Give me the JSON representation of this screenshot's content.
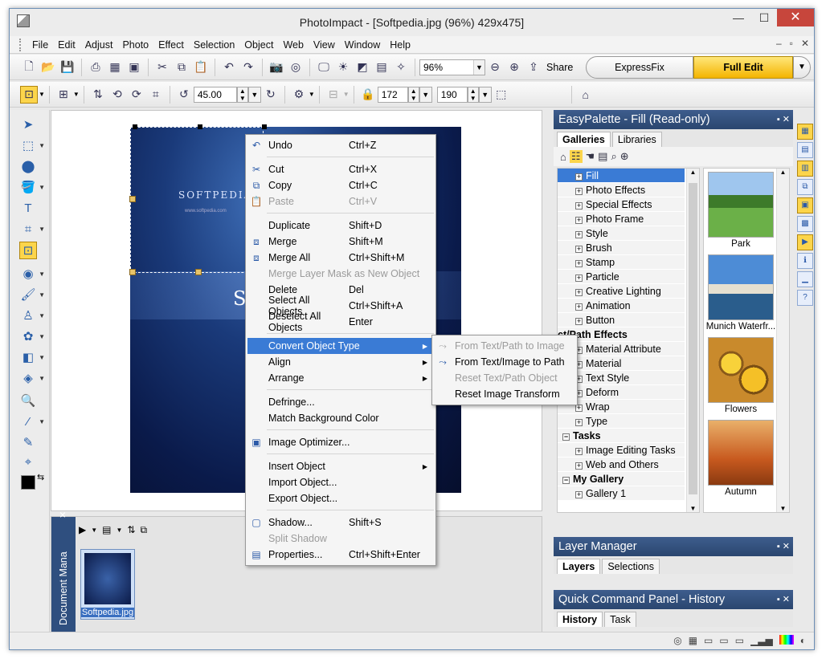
{
  "window": {
    "title": "PhotoImpact - [Softpedia.jpg (96%) 429x475]"
  },
  "menubar": [
    "File",
    "Edit",
    "Adjust",
    "Photo",
    "Effect",
    "Selection",
    "Object",
    "Web",
    "View",
    "Window",
    "Help"
  ],
  "toolbar1": {
    "zoom_value": "96%",
    "share_label": "Share",
    "expressfix_label": "ExpressFix",
    "fulledit_label": "Full Edit"
  },
  "toolbar2": {
    "rotate_value": "45.00",
    "width_value": "172",
    "height_value": "190"
  },
  "document": {
    "logo_text": "SOFTPEDIA",
    "url_text": "www.softpedia.com",
    "big_letter": "S"
  },
  "context_menu": {
    "items": [
      {
        "label": "Undo",
        "shortcut": "Ctrl+Z"
      },
      {
        "label": "Cut",
        "shortcut": "Ctrl+X"
      },
      {
        "label": "Copy",
        "shortcut": "Ctrl+C"
      },
      {
        "label": "Paste",
        "shortcut": "Ctrl+V"
      },
      {
        "label": "Duplicate",
        "shortcut": "Shift+D"
      },
      {
        "label": "Merge",
        "shortcut": "Shift+M"
      },
      {
        "label": "Merge All",
        "shortcut": "Ctrl+Shift+M"
      },
      {
        "label": "Merge Layer Mask as New Object",
        "shortcut": ""
      },
      {
        "label": "Delete",
        "shortcut": "Del"
      },
      {
        "label": "Select All Objects",
        "shortcut": "Ctrl+Shift+A"
      },
      {
        "label": "Deselect All Objects",
        "shortcut": "Enter"
      },
      {
        "label": "Convert Object Type",
        "shortcut": ""
      },
      {
        "label": "Align",
        "shortcut": ""
      },
      {
        "label": "Arrange",
        "shortcut": ""
      },
      {
        "label": "Defringe...",
        "shortcut": ""
      },
      {
        "label": "Match Background Color",
        "shortcut": ""
      },
      {
        "label": "Image Optimizer...",
        "shortcut": ""
      },
      {
        "label": "Insert Object",
        "shortcut": ""
      },
      {
        "label": "Import Object...",
        "shortcut": ""
      },
      {
        "label": "Export Object...",
        "shortcut": ""
      },
      {
        "label": "Shadow...",
        "shortcut": "Shift+S"
      },
      {
        "label": "Split Shadow",
        "shortcut": ""
      },
      {
        "label": "Properties...",
        "shortcut": "Ctrl+Shift+Enter"
      }
    ]
  },
  "submenu": {
    "items": [
      {
        "label": "From Text/Path to Image"
      },
      {
        "label": "From Text/Image to Path"
      },
      {
        "label": "Reset Text/Path Object"
      },
      {
        "label": "Reset Image Transform"
      }
    ]
  },
  "easypalette": {
    "title": "EasyPalette - Fill (Read-only)",
    "tabs": [
      "Galleries",
      "Libraries"
    ],
    "tree": [
      "Fill",
      "Photo Effects",
      "Special Effects",
      "Photo Frame",
      "Style",
      "Brush",
      "Stamp",
      "Particle",
      "Creative Lighting",
      "Animation",
      "Button",
      "ct/Path Effects",
      "Material Attribute",
      "Material",
      "Text Style",
      "Deform",
      "Wrap",
      "Type",
      "Tasks",
      "Image Editing Tasks",
      "Web and Others",
      "My Gallery",
      "Gallery 1"
    ],
    "gallery": [
      "Park",
      "Munich Waterfr...",
      "Flowers",
      "Autumn"
    ]
  },
  "layer_manager": {
    "title": "Layer Manager",
    "tabs": [
      "Layers",
      "Selections"
    ]
  },
  "quick_command": {
    "title": "Quick Command Panel - History",
    "tabs": [
      "History",
      "Task"
    ]
  },
  "document_manager": {
    "label": "Document Mana",
    "thumb_caption": "Softpedia.jpg"
  }
}
